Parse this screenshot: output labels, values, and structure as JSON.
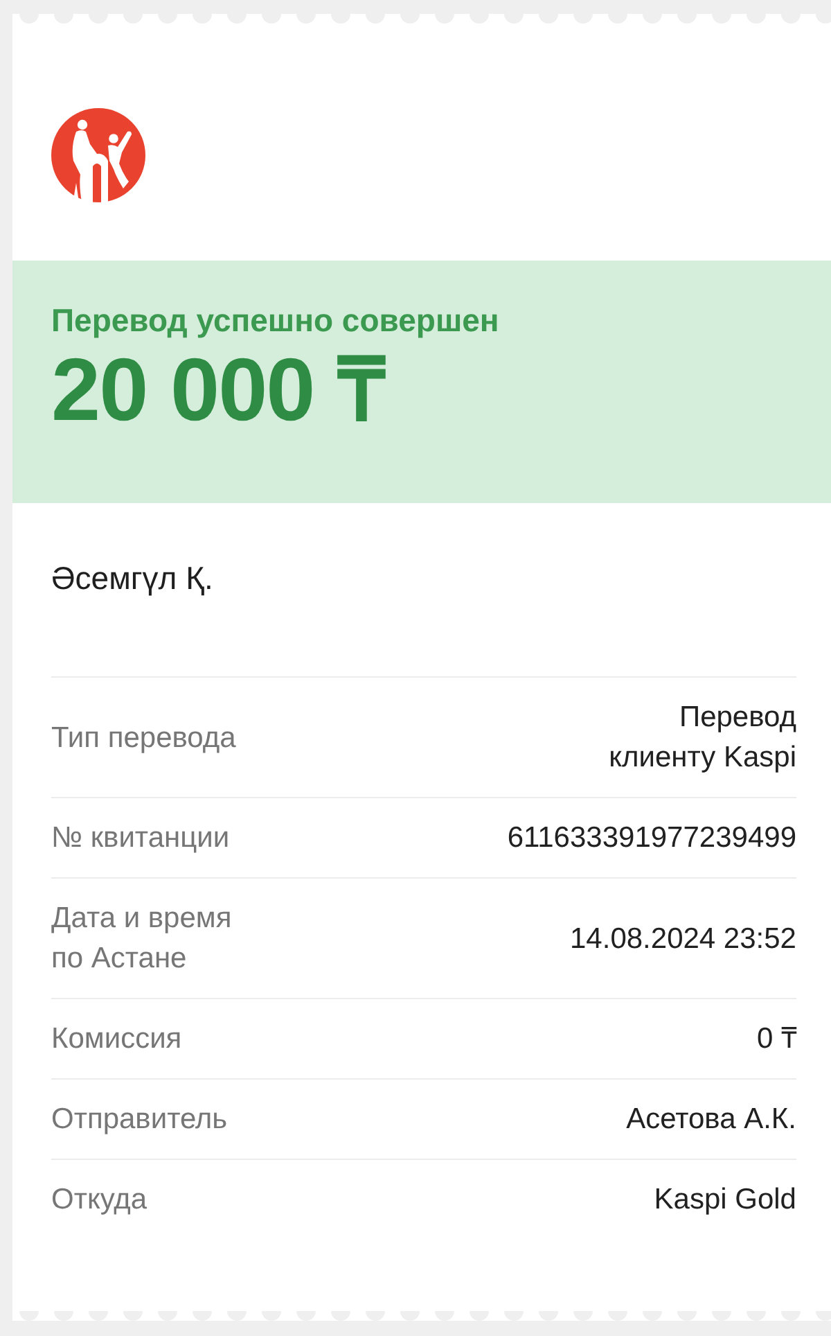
{
  "status": {
    "title": "Перевод успешно совершен",
    "amount": "20 000 ₸"
  },
  "recipient": "Әсемгүл Қ.",
  "details": [
    {
      "label": "Тип перевода",
      "value": "Перевод\nклиенту Kaspi"
    },
    {
      "label": "№ квитанции",
      "value": "611633391977239499"
    },
    {
      "label": "Дата и время\nпо Астане",
      "value": "14.08.2024 23:52"
    },
    {
      "label": "Комиссия",
      "value": "0 ₸"
    },
    {
      "label": "Отправитель",
      "value": "Асетова А.К."
    },
    {
      "label": "Откуда",
      "value": "Kaspi Gold"
    }
  ]
}
